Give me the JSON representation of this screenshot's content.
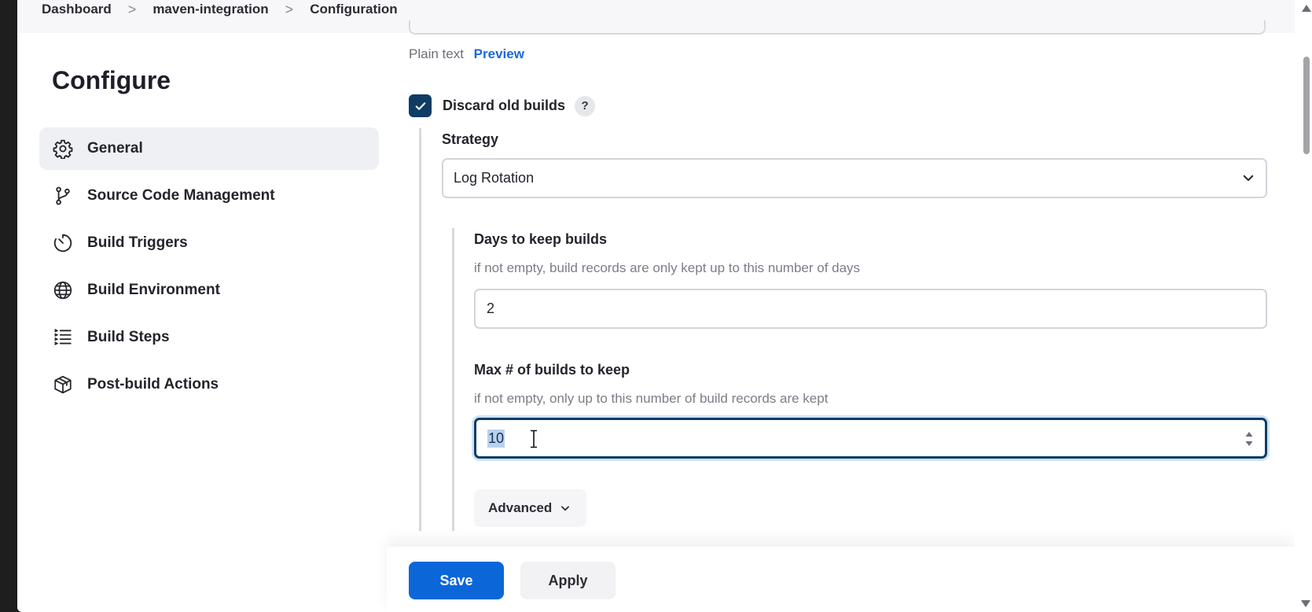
{
  "breadcrumb": {
    "items": [
      "Dashboard",
      "maven-integration",
      "Configuration"
    ],
    "separator": ">"
  },
  "sidebar": {
    "title": "Configure",
    "items": [
      {
        "label": "General",
        "icon": "gear-icon",
        "active": true
      },
      {
        "label": "Source Code Management",
        "icon": "git-branch-icon",
        "active": false
      },
      {
        "label": "Build Triggers",
        "icon": "timer-icon",
        "active": false
      },
      {
        "label": "Build Environment",
        "icon": "globe-icon",
        "active": false
      },
      {
        "label": "Build Steps",
        "icon": "list-steps-icon",
        "active": false
      },
      {
        "label": "Post-build Actions",
        "icon": "package-icon",
        "active": false
      }
    ]
  },
  "main": {
    "markup": {
      "plain": "Plain text",
      "preview": "Preview"
    },
    "discard": {
      "label": "Discard old builds",
      "checked": true,
      "help": "?"
    },
    "strategy": {
      "label": "Strategy",
      "selected": "Log Rotation"
    },
    "days": {
      "label": "Days to keep builds",
      "hint": "if not empty, build records are only kept up to this number of days",
      "value": "2"
    },
    "max_builds": {
      "label": "Max # of builds to keep",
      "hint": "if not empty, only up to this number of build records are kept",
      "value": "10"
    },
    "advanced_label": "Advanced"
  },
  "footer": {
    "save_label": "Save",
    "apply_label": "Apply"
  },
  "colors": {
    "primary": "#0b67d8",
    "checkbox": "#0f3c64",
    "focus_ring": "#cfe3f6",
    "link": "#1769d9"
  }
}
